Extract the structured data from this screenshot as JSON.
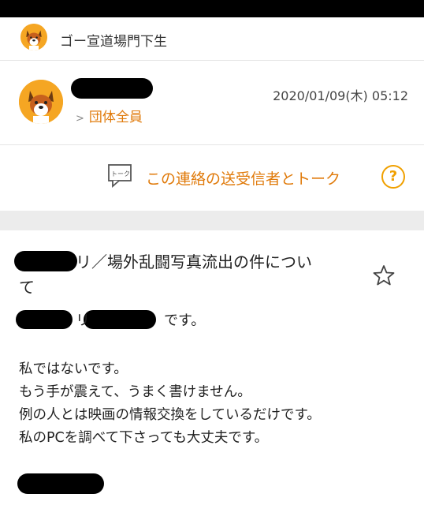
{
  "group": {
    "name": "ゴー宣道場門下生",
    "avatar_icon": "shiba-dog-icon"
  },
  "sender": {
    "avatar_icon": "shiba-dog-icon",
    "recipients_label": "団体全員",
    "datetime": "2020/01/09(木) 05:12"
  },
  "talk": {
    "icon": "talk-bubble-icon",
    "icon_text": "トーク",
    "label": "この連絡の送受信者とトーク",
    "help_glyph": "?"
  },
  "message": {
    "subject_line1": "リ／場外乱闘写真流出の件につい",
    "subject_line2": "て",
    "author_mid": "リ",
    "author_suffix": "です。",
    "body": [
      "私ではないです。",
      "もう手が震えて、うまく書けません。",
      "例の人とは映画の情報交換をしているだけです。",
      "私のPCを調べて下さっても大丈夫です。"
    ]
  },
  "colors": {
    "accent": "#e07a0a",
    "help": "#f0a000",
    "avatar": "#f5a623"
  }
}
